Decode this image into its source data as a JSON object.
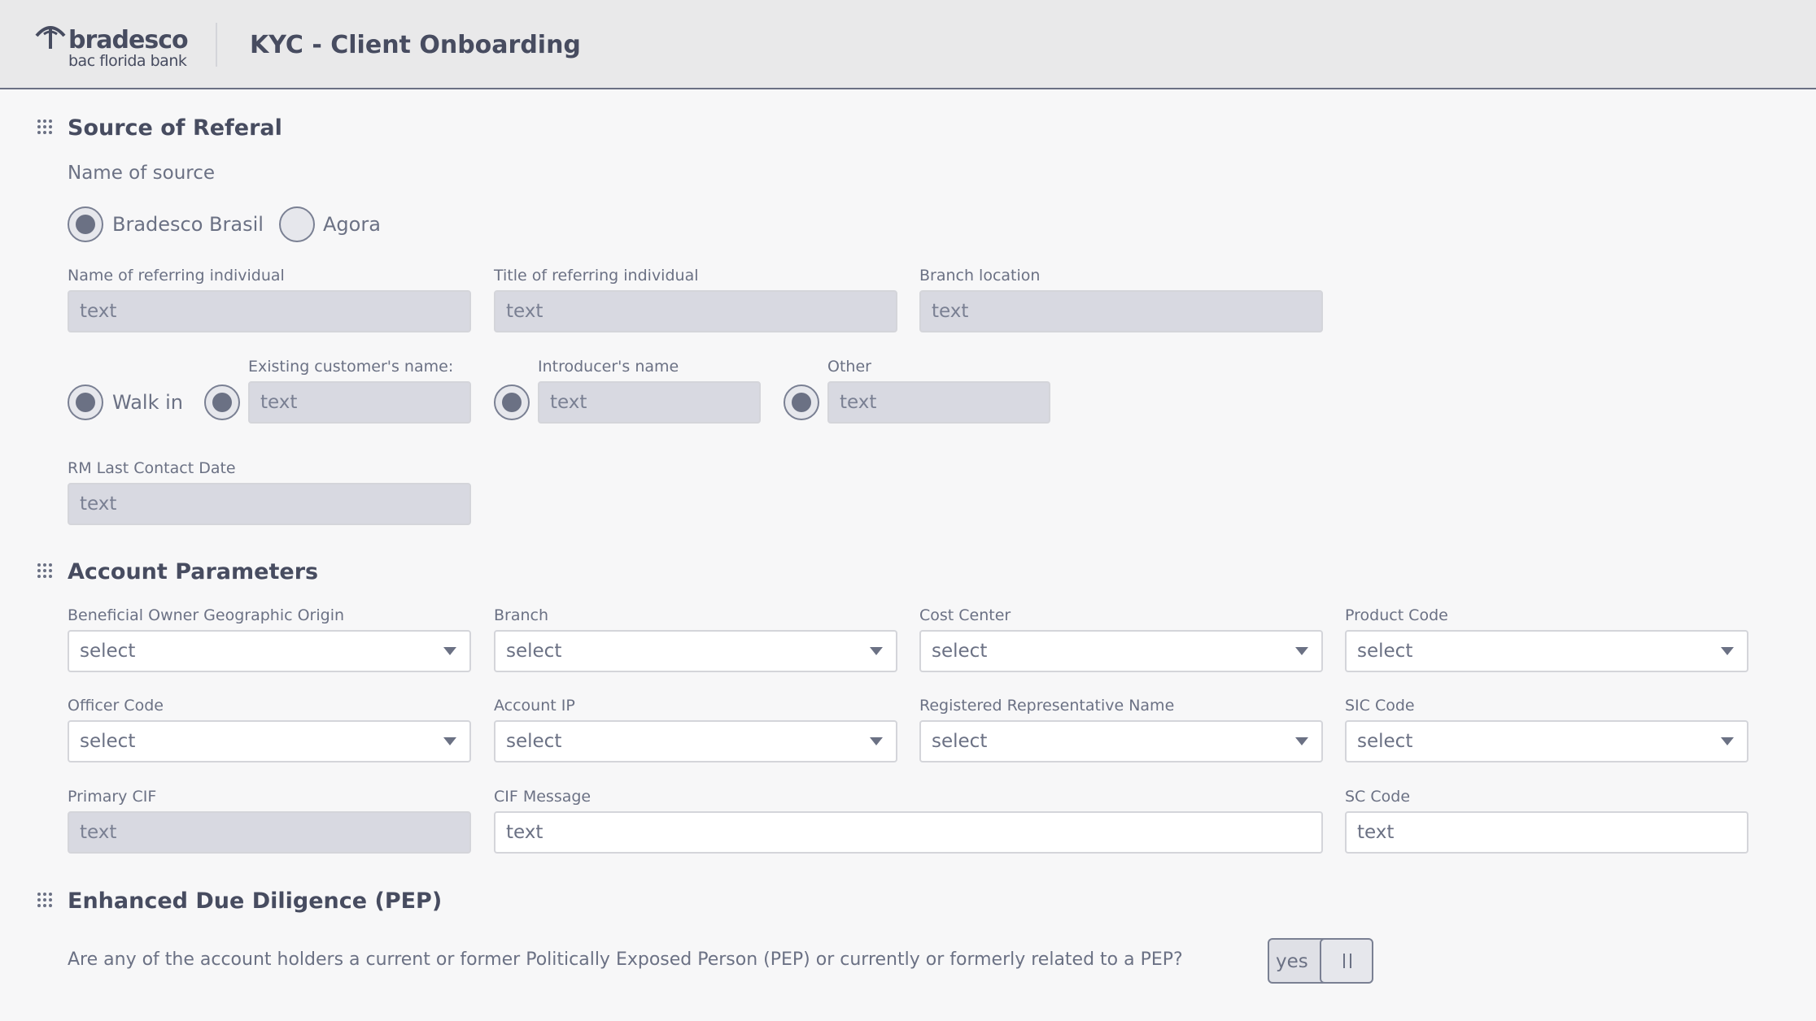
{
  "header": {
    "logo_name": "bradesco",
    "logo_sub": "bac florida bank",
    "title": "KYC - Client Onboarding"
  },
  "referral": {
    "title": "Source of Referal",
    "name_of_source_label": "Name of source",
    "sources": [
      {
        "label": "Bradesco Brasil",
        "selected": true
      },
      {
        "label": "Agora",
        "selected": false
      }
    ],
    "referring_name_label": "Name of referring individual",
    "referring_name_placeholder": "text",
    "referring_title_label": "Title of referring individual",
    "referring_title_placeholder": "text",
    "branch_location_label": "Branch location",
    "branch_location_placeholder": "text",
    "walk_in_label": "Walk in",
    "existing_customer_label": "Existing customer's name:",
    "existing_customer_placeholder": "text",
    "introducer_label": "Introducer's name",
    "introducer_placeholder": "text",
    "other_label": "Other",
    "other_placeholder": "text",
    "rm_date_label": "RM Last Contact Date",
    "rm_date_placeholder": "text"
  },
  "account": {
    "title": "Account Parameters",
    "selects": [
      {
        "label": "Beneficial Owner Geographic Origin",
        "value": "select"
      },
      {
        "label": "Branch",
        "value": "select"
      },
      {
        "label": "Cost Center",
        "value": "select"
      },
      {
        "label": "Product Code",
        "value": "select"
      },
      {
        "label": "Officer Code",
        "value": "select"
      },
      {
        "label": "Account IP",
        "value": "select"
      },
      {
        "label": "Registered Representative Name",
        "value": "select"
      },
      {
        "label": "SIC Code",
        "value": "select"
      }
    ],
    "primary_cif_label": "Primary CIF",
    "primary_cif_placeholder": "text",
    "cif_message_label": "CIF Message",
    "cif_message_placeholder": "text",
    "sc_code_label": "SC Code",
    "sc_code_placeholder": "text"
  },
  "pep": {
    "title": "Enhanced Due Diligence (PEP)",
    "question": "Are any of the account holders a current or former Politically Exposed Person (PEP) or currently or formerly related to a PEP?",
    "toggle_label": "yes"
  },
  "colors": {
    "background": "#f7f7f8",
    "header_bg": "#e9e9ea",
    "text_dark": "#474c60",
    "text_muted": "#6b7184",
    "input_disabled": "#d8d9e1"
  }
}
